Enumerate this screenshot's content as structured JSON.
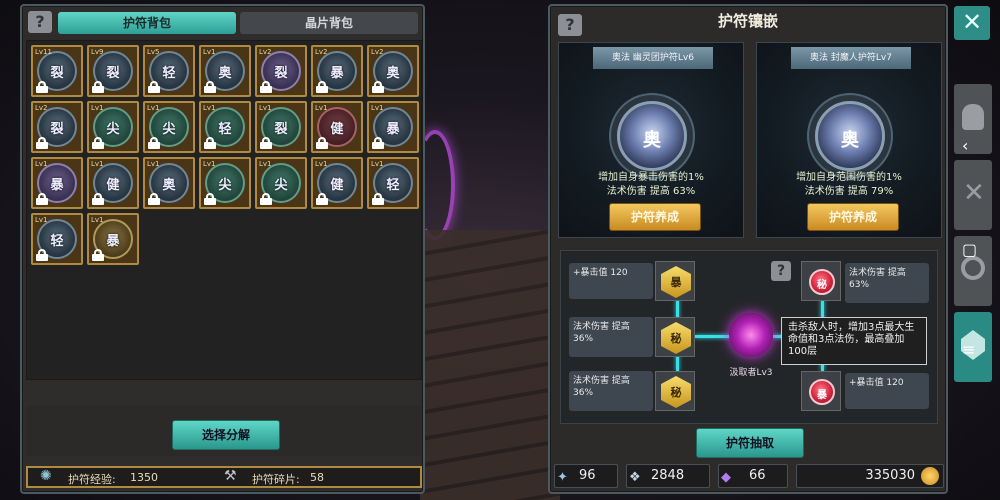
{
  "left_panel": {
    "help": "?",
    "tabs": [
      {
        "label": "护符背包",
        "active": true
      },
      {
        "label": "晶片背包",
        "active": false
      }
    ],
    "amulets": [
      {
        "lv": "Lv11",
        "ch": "裂",
        "color": "blue"
      },
      {
        "lv": "Lv9",
        "ch": "裂",
        "color": "blue"
      },
      {
        "lv": "Lv5",
        "ch": "轻",
        "color": "blue"
      },
      {
        "lv": "Lv1",
        "ch": "奥",
        "color": "blue"
      },
      {
        "lv": "Lv2",
        "ch": "裂",
        "color": "purple"
      },
      {
        "lv": "Lv2",
        "ch": "暴",
        "color": "blue"
      },
      {
        "lv": "Lv2",
        "ch": "奥",
        "color": "blue"
      },
      {
        "lv": "Lv2",
        "ch": "裂",
        "color": "blue"
      },
      {
        "lv": "Lv1",
        "ch": "尖",
        "color": "green"
      },
      {
        "lv": "Lv1",
        "ch": "尖",
        "color": "green"
      },
      {
        "lv": "Lv1",
        "ch": "轻",
        "color": "green"
      },
      {
        "lv": "Lv1",
        "ch": "裂",
        "color": "green"
      },
      {
        "lv": "Lv1",
        "ch": "健",
        "color": "red"
      },
      {
        "lv": "Lv1",
        "ch": "暴",
        "color": "blue"
      },
      {
        "lv": "Lv1",
        "ch": "暴",
        "color": "purple"
      },
      {
        "lv": "Lv1",
        "ch": "健",
        "color": "blue"
      },
      {
        "lv": "Lv1",
        "ch": "奥",
        "color": "blue"
      },
      {
        "lv": "Lv1",
        "ch": "尖",
        "color": "green"
      },
      {
        "lv": "Lv1",
        "ch": "尖",
        "color": "green"
      },
      {
        "lv": "Lv1",
        "ch": "健",
        "color": "blue"
      },
      {
        "lv": "Lv1",
        "ch": "轻",
        "color": "blue"
      },
      {
        "lv": "Lv1",
        "ch": "轻",
        "color": "blue"
      },
      {
        "lv": "Lv1",
        "ch": "暴",
        "color": "gold"
      }
    ],
    "decompose_button": "选择分解",
    "exp_label": "护符经验:",
    "exp_value": "1350",
    "shard_label": "护符碎片:",
    "shard_value": "58"
  },
  "right_panel": {
    "help": "?",
    "title": "护符镶嵌",
    "cards": [
      {
        "tag": "奥法  幽灵团护符Lv6",
        "ch": "奥",
        "desc1": "增加自身暴击伤害的1%",
        "desc2": "法术伤害  提高  63%",
        "button": "护符养成"
      },
      {
        "tag": "奥法  封魔人护符Lv7",
        "ch": "奥",
        "desc1": "增加自身范围伤害的1%",
        "desc2": "法术伤害  提高  79%",
        "button": "护符养成"
      }
    ],
    "left_stats": [
      {
        "text": "+暴击值  120",
        "ch": "暴"
      },
      {
        "text": "法术伤害  提高\n36%",
        "ch": "秘"
      },
      {
        "text": "法术伤害  提高\n36%",
        "ch": "秘"
      }
    ],
    "right_stats": [
      {
        "text": "法术伤害  提高\n63%",
        "ch": "秘"
      },
      {
        "text": "+暴击值  120",
        "ch": "暴"
      }
    ],
    "core_label": "汲取者Lv3",
    "tooltip": "击杀敌人时，增加3点最大生命值和3点法伤，最高叠加100层",
    "draw_button": "护符抽取",
    "currencies": [
      {
        "icon": "wand-icon",
        "value": "96"
      },
      {
        "icon": "crystal-icon",
        "value": "2848"
      },
      {
        "icon": "purple-gem-icon",
        "value": "66"
      },
      {
        "icon": "gold-coin-icon",
        "value": "335030"
      }
    ]
  },
  "close": "✕",
  "overlay_nav": {
    "back": "‹",
    "home": "▢",
    "menu": "≡"
  }
}
